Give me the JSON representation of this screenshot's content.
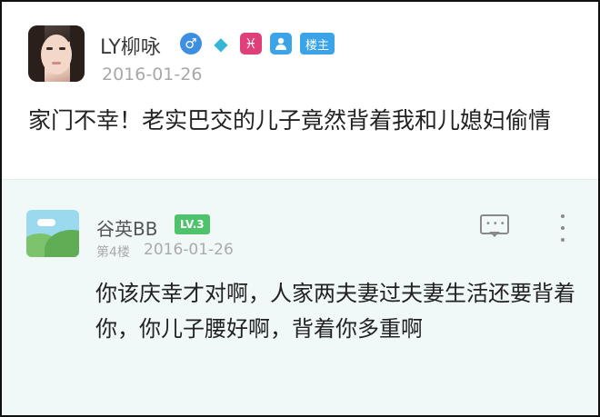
{
  "post": {
    "username": "LY柳咏",
    "date": "2016-01-26",
    "owner_badge": "楼主",
    "badges": [
      "male-icon",
      "gem-icon",
      "zodiac-icon",
      "person-icon"
    ],
    "title": "家门不幸！老实巴交的儿子竟然背着我和儿媳妇偷情"
  },
  "reply": {
    "username": "谷英BB",
    "level": "LV.3",
    "floor": "第4楼",
    "date": "2016-01-26",
    "text": "你该庆幸才对啊，人家两夫妻过夫妻生活还要背着你，你儿子腰好啊，背着你多重啊"
  },
  "colors": {
    "accent_blue": "#3ba3e8",
    "level_green": "#4fc36b",
    "reply_bg": "#f1f8f8",
    "date_gray": "#a8a8a8"
  }
}
